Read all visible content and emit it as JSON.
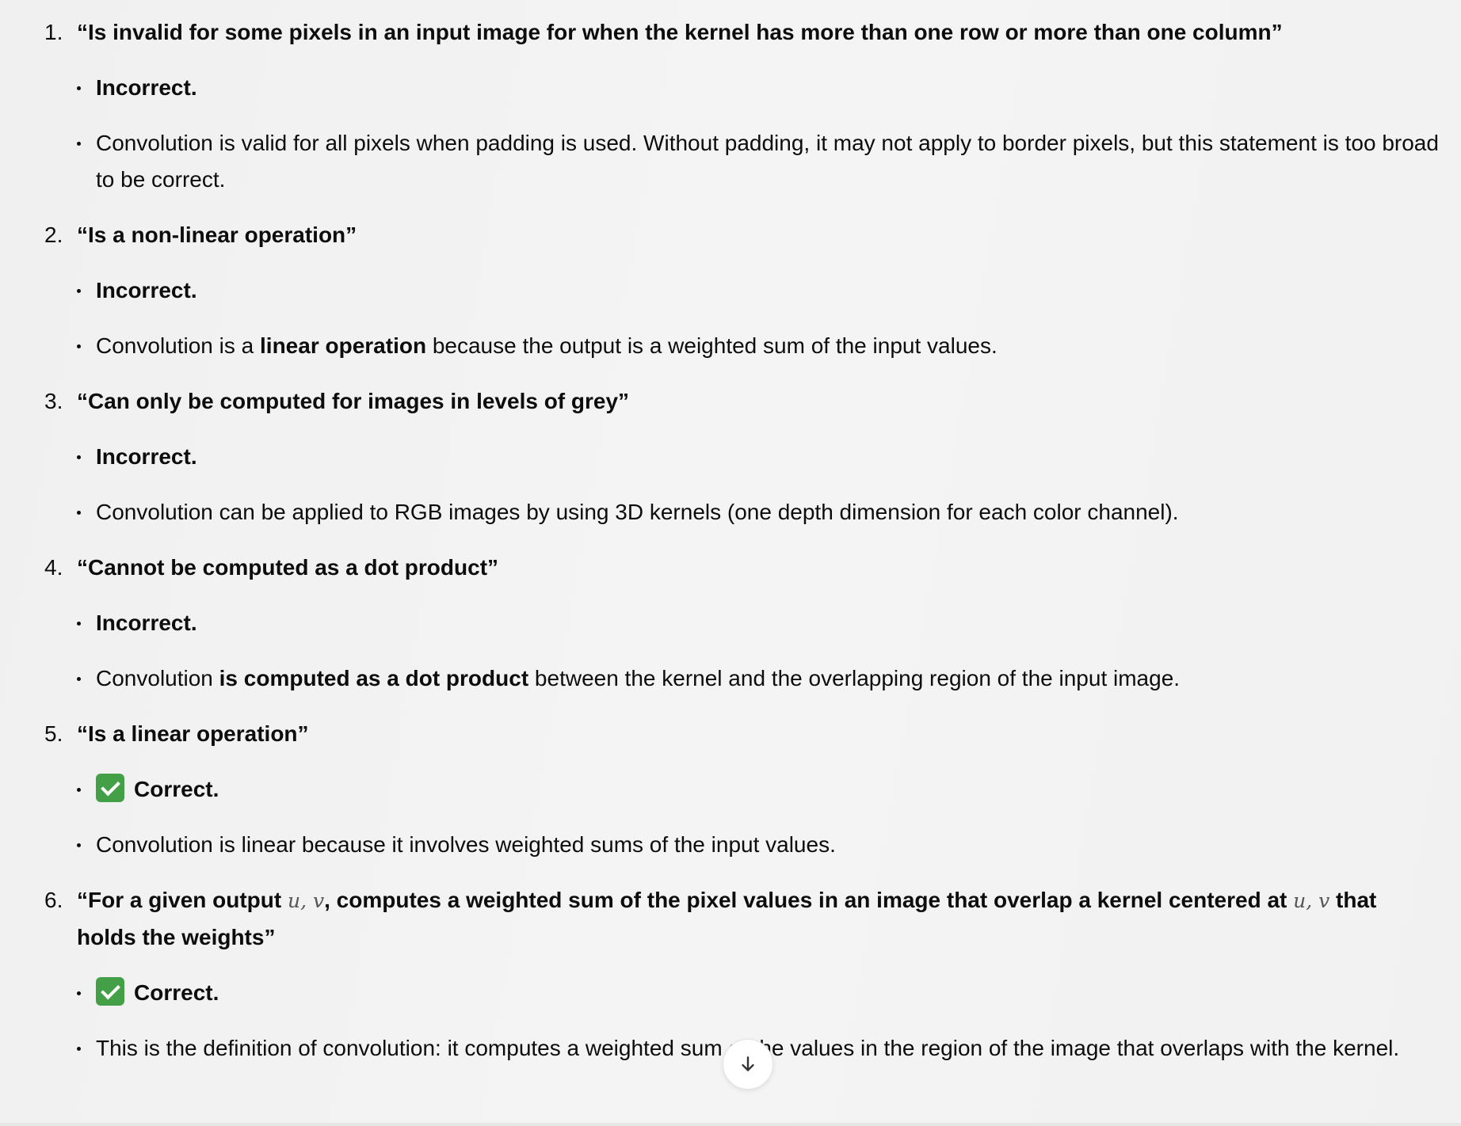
{
  "colors": {
    "text": "#0d0d0d",
    "check_bg": "#43a047",
    "background": "#f2f2f2"
  },
  "icons": {
    "check": "check-mark-button-icon",
    "scroll": "arrow-down-icon"
  },
  "items": [
    {
      "num": "1.",
      "title": "“Is invalid for some pixels in an input image for when the kernel has more than one row or more than one column”",
      "verdict": "Incorrect.",
      "expl": "Convolution is valid for all pixels when padding is used. Without padding, it may not apply to border pixels, but this statement is too broad to be correct."
    },
    {
      "num": "2.",
      "title": "“Is a non-linear operation”",
      "verdict": "Incorrect.",
      "expl_pre": "Convolution is a ",
      "expl_bold": "linear operation",
      "expl_post": " because the output is a weighted sum of the input values."
    },
    {
      "num": "3.",
      "title": "“Can only be computed for images in levels of grey”",
      "verdict": "Incorrect.",
      "expl": "Convolution can be applied to RGB images by using 3D kernels (one depth dimension for each color channel)."
    },
    {
      "num": "4.",
      "title": "“Cannot be computed as a dot product”",
      "verdict": "Incorrect.",
      "expl_pre": "Convolution ",
      "expl_bold": "is computed as a dot product",
      "expl_post": " between the kernel and the overlapping region of the input image."
    },
    {
      "num": "5.",
      "title": "“Is a linear operation”",
      "verdict": "Correct.",
      "expl": "Convolution is linear because it involves weighted sums of the input values."
    },
    {
      "num": "6.",
      "title_a": "“For a given output ",
      "var": "u, v",
      "title_b": ", computes a weighted sum of the pixel values in an image that overlap a kernel centered at ",
      "title_c": " that holds the weights”",
      "verdict": "Correct.",
      "expl": "This is the definition of convolution: it computes a weighted sum of the values in the region of the image that overlaps with the kernel."
    }
  ]
}
